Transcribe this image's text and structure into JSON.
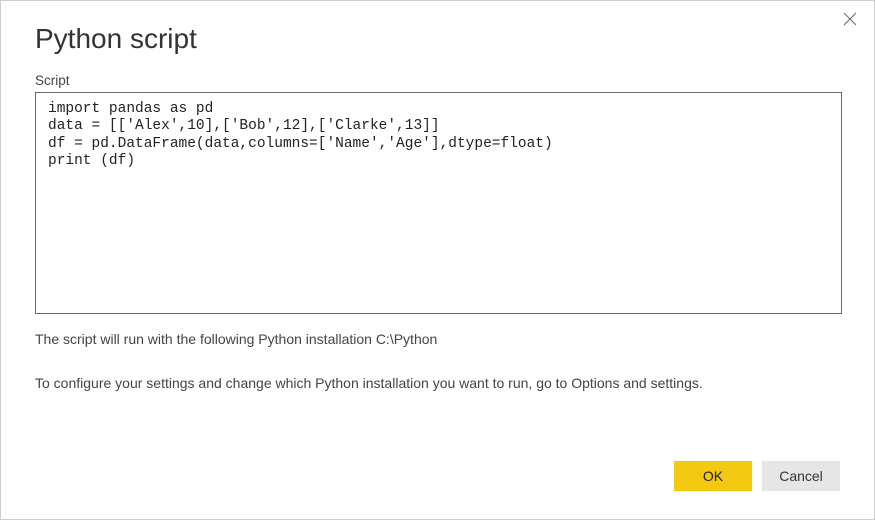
{
  "dialog": {
    "title": "Python script",
    "close_icon": "close"
  },
  "script_field": {
    "label": "Script",
    "value": "import pandas as pd\ndata = [['Alex',10],['Bob',12],['Clarke',13]]\ndf = pd.DataFrame(data,columns=['Name','Age'],dtype=float)\nprint (df)"
  },
  "info": {
    "install_path_text": "The script will run with the following Python installation C:\\Python",
    "configure_text": "To configure your settings and change which Python installation you want to run, go to Options and settings."
  },
  "buttons": {
    "ok_label": "OK",
    "cancel_label": "Cancel"
  }
}
